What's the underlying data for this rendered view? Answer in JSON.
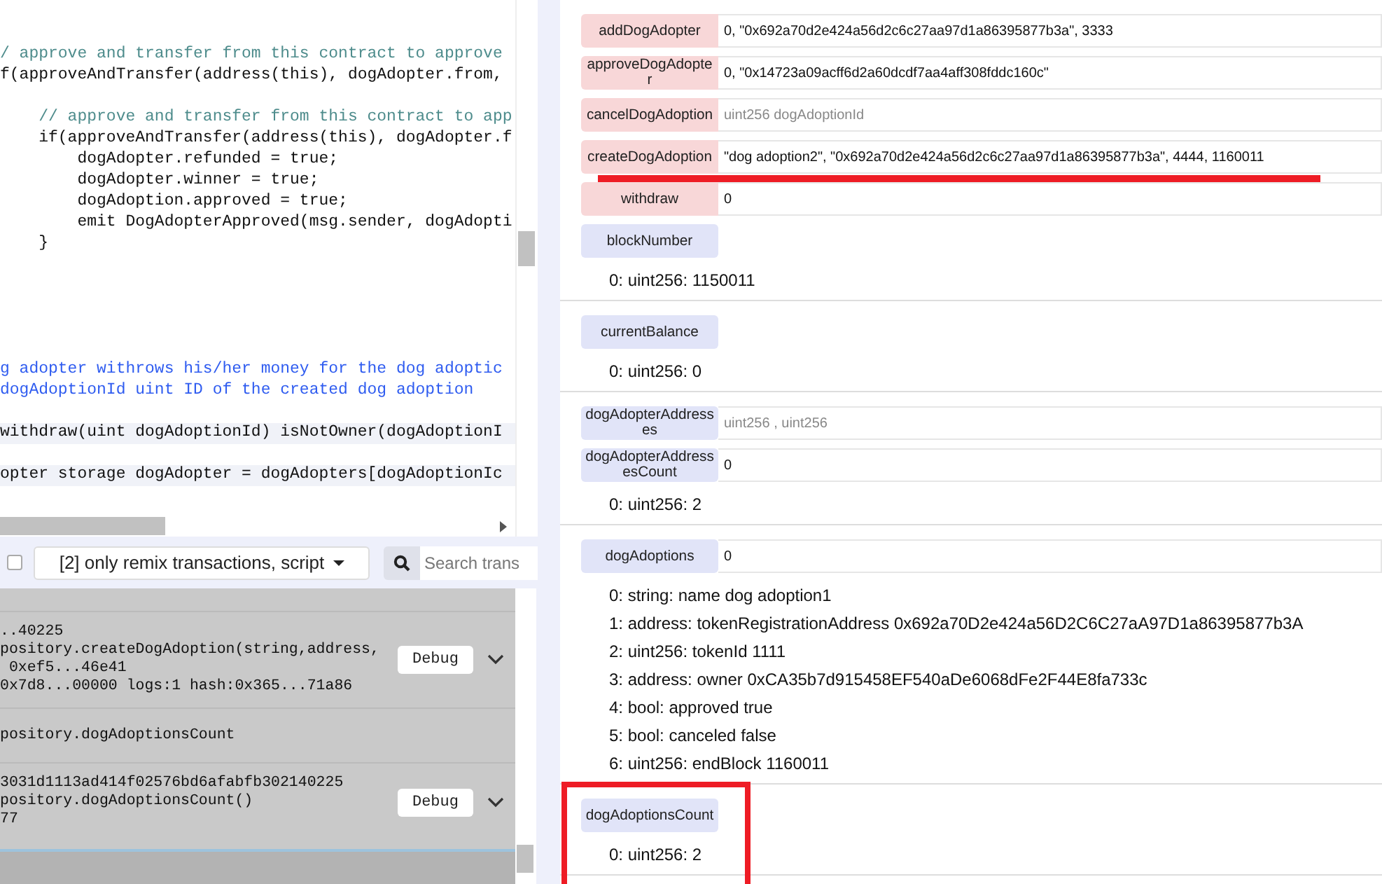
{
  "editor": {
    "lines": [
      {
        "kind": "blank"
      },
      {
        "kind": "blank"
      },
      {
        "kind": "comment",
        "text": "/ approve and transfer from this contract to approve",
        "highlighted": false
      },
      {
        "kind": "code",
        "text": "f(approveAndTransfer(address(this), dogAdopter.from,",
        "highlighted": false
      },
      {
        "kind": "blank"
      },
      {
        "kind": "comment",
        "text": "    // approve and transfer from this contract to app",
        "highlighted": false
      },
      {
        "kind": "code",
        "text": "    if(approveAndTransfer(address(this), dogAdopter.f",
        "highlighted": false
      },
      {
        "kind": "code",
        "text": "        dogAdopter.refunded = true;",
        "highlighted": false
      },
      {
        "kind": "code",
        "text": "        dogAdopter.winner = true;",
        "highlighted": false
      },
      {
        "kind": "code",
        "text": "        dogAdoption.approved = true;",
        "highlighted": false
      },
      {
        "kind": "code",
        "text": "        emit DogAdopterApproved(msg.sender, dogAdopti",
        "highlighted": false
      },
      {
        "kind": "code",
        "text": "    }",
        "highlighted": false
      },
      {
        "kind": "blank"
      },
      {
        "kind": "blank"
      },
      {
        "kind": "blank"
      },
      {
        "kind": "blank"
      },
      {
        "kind": "blank"
      },
      {
        "kind": "doc",
        "text": "g adopter withrows his/her money for the dog adoptic",
        "highlighted": false
      },
      {
        "kind": "doc",
        "text": "dogAdoptionId uint ID of the created dog adoption",
        "highlighted": false
      },
      {
        "kind": "blank"
      },
      {
        "kind": "code",
        "text": "withdraw(uint dogAdoptionId) isNotOwner(dogAdoptionI",
        "highlighted": true
      },
      {
        "kind": "blank"
      },
      {
        "kind": "code",
        "text": "opter storage dogAdopter = dogAdopters[dogAdoptionIc",
        "highlighted": true
      }
    ]
  },
  "terminal": {
    "filter_checked": false,
    "filter": "[2] only remix transactions, script",
    "search": {
      "placeholder": "Search trans"
    },
    "entries": [
      {
        "lines": [
          "..40225",
          "pository.createDogAdoption(string,address,",
          " 0xef5...46e41",
          "0x7d8...00000 logs:1 hash:0x365...71a86"
        ],
        "button": "Debug",
        "expanded": false
      },
      {
        "lines": [
          "pository.dogAdoptionsCount"
        ]
      },
      {
        "lines": [
          "3031d1113ad414f02576bd6afabfb302140225",
          "pository.dogAdoptionsCount()",
          "77"
        ],
        "button": "Debug",
        "expanded": false
      }
    ]
  },
  "sections": [
    {
      "functions": [
        {
          "name": "addDogAdopter",
          "kind": "transact",
          "value": "0, \"0x692a70d2e424a56d2c6c27aa97d1a86395877b3a\", 3333"
        },
        {
          "name": "approveDogAdopter",
          "kind": "transact",
          "value": "0, \"0x14723a09acff6d2a60dcdf7aa4aff308fddc160c\""
        },
        {
          "name": "cancelDogAdoption",
          "kind": "transact",
          "placeholder": "uint256 dogAdoptionId"
        },
        {
          "name": "createDogAdoption",
          "kind": "transact",
          "value": "\"dog adoption2\", \"0x692a70d2e424a56d2c6c27aa97d1a86395877b3a\", 4444, 1160011",
          "underlined": true
        },
        {
          "name": "withdraw",
          "kind": "transact",
          "value": "0"
        },
        {
          "name": "blockNumber",
          "kind": "call"
        }
      ],
      "results": [
        "0: uint256: 1150011"
      ]
    },
    {
      "functions": [
        {
          "name": "currentBalance",
          "kind": "call"
        }
      ],
      "results": [
        "0: uint256: 0"
      ]
    },
    {
      "functions": [
        {
          "name": "dogAdopterAddresses",
          "kind": "call",
          "placeholder": "uint256 , uint256"
        },
        {
          "name": "dogAdopterAddressesCount",
          "kind": "call",
          "value": "0"
        }
      ],
      "results": [
        "0: uint256: 2"
      ]
    },
    {
      "functions": [
        {
          "name": "dogAdoptions",
          "kind": "call",
          "value": "0"
        }
      ],
      "results": [
        "0: string: name dog adoption1",
        "1: address: tokenRegistrationAddress 0x692a70D2e424a56D2C6C27aA97D1a86395877b3A",
        "2: uint256: tokenId 1111",
        "3: address: owner 0xCA35b7d915458EF540aDe6068dFe2F44E8fa733c",
        "4: bool: approved true",
        "5: bool: canceled false",
        "6: uint256: endBlock 1160011"
      ]
    },
    {
      "functions": [
        {
          "name": "dogAdoptionsCount",
          "kind": "call"
        }
      ],
      "results": [
        "0: uint256: 2"
      ],
      "boxed": true
    }
  ]
}
